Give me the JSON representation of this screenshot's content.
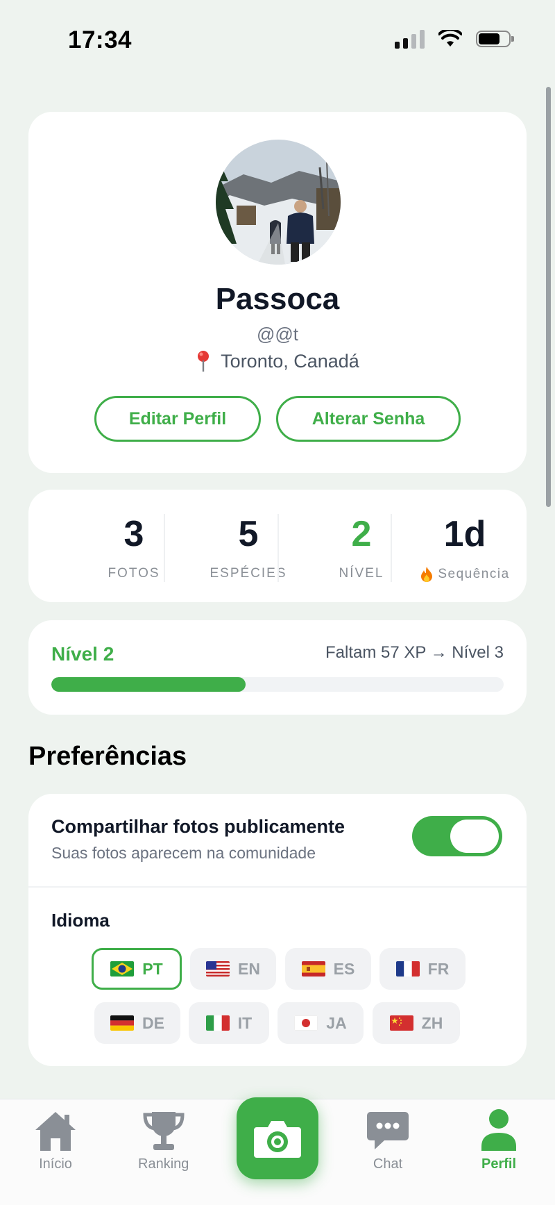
{
  "status_bar": {
    "time": "17:34"
  },
  "profile": {
    "name": "Passoca",
    "handle": "@@t",
    "location": "Toronto, Canadá",
    "edit_button": "Editar Perfil",
    "password_button": "Alterar Senha"
  },
  "stats": [
    {
      "value": "3",
      "label": "FOTOS"
    },
    {
      "value": "5",
      "label": "ESPÉCIES"
    },
    {
      "value": "2",
      "label": "NÍVEL"
    },
    {
      "value": "1d",
      "label": "Sequência",
      "icon": "fire-icon"
    }
  ],
  "level": {
    "title": "Nível 2",
    "next": "Faltam 57 XP → Nível 3",
    "progress": 0.43
  },
  "preferences": {
    "section_title": "Preferências",
    "share_title": "Compartilhar fotos publicamente",
    "share_subtitle": "Suas fotos aparecem na comunidade",
    "share_enabled": true,
    "language_title": "Idioma",
    "languages": [
      {
        "code": "PT",
        "selected": true
      },
      {
        "code": "EN",
        "selected": false
      },
      {
        "code": "ES",
        "selected": false
      },
      {
        "code": "FR",
        "selected": false
      },
      {
        "code": "DE",
        "selected": false
      },
      {
        "code": "IT",
        "selected": false
      },
      {
        "code": "JA",
        "selected": false
      },
      {
        "code": "ZH",
        "selected": false
      }
    ]
  },
  "nav": {
    "home": "Início",
    "ranking": "Ranking",
    "chat": "Chat",
    "profile": "Perfil",
    "active": "profile"
  },
  "colors": {
    "accent": "#3fae49",
    "background": "#eef3ef"
  }
}
